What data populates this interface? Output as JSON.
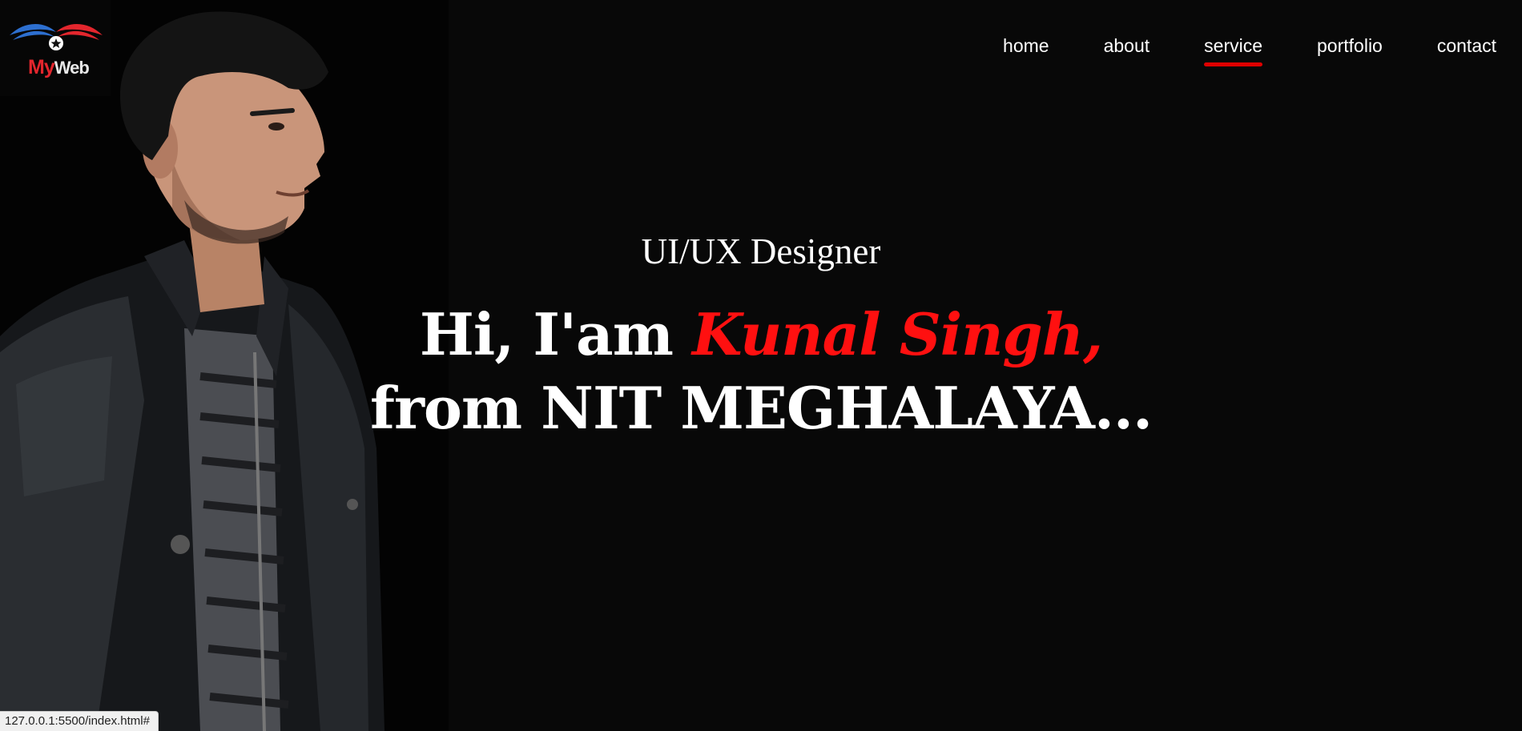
{
  "logo": {
    "alt": "MyWeb logo",
    "text_my": "My",
    "text_web": "Web"
  },
  "nav": {
    "items": [
      {
        "label": "home",
        "active": false
      },
      {
        "label": "about",
        "active": false
      },
      {
        "label": "service",
        "active": true
      },
      {
        "label": "portfolio",
        "active": false
      },
      {
        "label": "contact",
        "active": false
      }
    ]
  },
  "hero": {
    "subtitle": "UI/UX Designer",
    "greeting": "Hi, I'am ",
    "name": "Kunal Singh,",
    "line2": "from NIT MEGHALAYA..."
  },
  "status_bar": {
    "url": "127.0.0.1:5500/index.html#"
  },
  "colors": {
    "background": "#080808",
    "accent": "#ff1010",
    "nav_underline": "#e00000",
    "text": "#ffffff"
  }
}
